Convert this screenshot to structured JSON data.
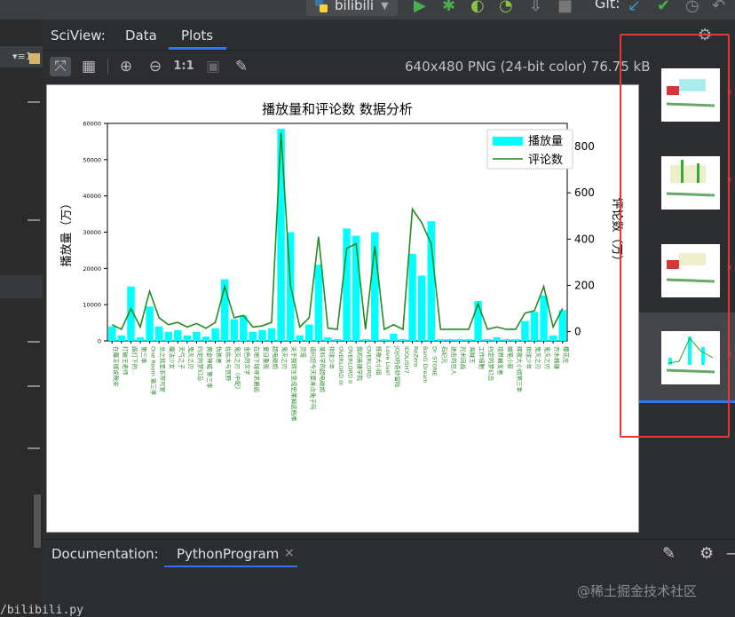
{
  "toolbar": {
    "run_config": "bilibili",
    "git_label": "Git:"
  },
  "left_strip": {
    "tab_label": "▾≡1"
  },
  "sciview": {
    "title": "SciView:",
    "tabs": [
      {
        "label": "Data"
      },
      {
        "label": "Plots"
      }
    ],
    "image_info": "640x480 PNG (24-bit color) 76.75 kB",
    "zoom_actual_label": "1:1"
  },
  "documentation": {
    "label": "Documentation:",
    "tab": "PythonProgram",
    "close": "×"
  },
  "watermark": "@稀土掘金技术社区",
  "console_line": "/bilibili.py",
  "chart_data": {
    "type": "bar",
    "title": "播放量和评论数 数据分析",
    "ylabel": "播放量（万）",
    "y2label": "评论数（万）",
    "ylim": [
      0,
      60000
    ],
    "y2lim": [
      -40,
      900
    ],
    "yticks": [
      0,
      10000,
      20000,
      30000,
      40000,
      50000,
      60000
    ],
    "y2ticks": [
      0,
      200,
      400,
      600,
      800
    ],
    "legend_position": "top-right",
    "series": [
      {
        "name": "播放量",
        "kind": "bar",
        "color": "#00ffff",
        "values": [
          4000,
          1500,
          15000,
          1000,
          9500,
          4000,
          2500,
          3000,
          1500,
          2500,
          1200,
          3500,
          17000,
          6000,
          7000,
          2500,
          3000,
          3500,
          58500,
          30000,
          1500,
          4500,
          21000,
          1000,
          500,
          31000,
          29000,
          500,
          30000,
          500,
          2000,
          500,
          24000,
          18000,
          33000,
          500,
          500,
          500,
          500,
          11000,
          500,
          1000,
          500,
          500,
          5500,
          8000,
          12500,
          1500,
          8500
        ]
      },
      {
        "name": "评论数",
        "kind": "line",
        "color": "#228b22",
        "values": [
          30,
          10,
          100,
          20,
          175,
          60,
          30,
          40,
          20,
          35,
          15,
          40,
          195,
          60,
          70,
          20,
          25,
          40,
          860,
          200,
          20,
          60,
          410,
          15,
          10,
          360,
          380,
          10,
          370,
          10,
          30,
          10,
          530,
          470,
          380,
          10,
          10,
          10,
          10,
          120,
          10,
          20,
          10,
          10,
          80,
          90,
          195,
          20,
          100
        ]
      }
    ],
    "categories": [
      "在魔王城说晚安",
      "打破王老师",
      "路灯下的...",
      "第三季",
      "One Room 第三季",
      "总之就是非常可爱",
      "魔法少女",
      "天气之子",
      "鬼灭之刃",
      "约定的梦幻岛",
      "黄金神威 第三季",
      "伪装者",
      "佐佐木与宫野",
      "鬼灭之刃（中配）",
      "金色的文字",
      "在地下城寻求邂逅",
      "夏日重现",
      "超电磁炮",
      "鬼灭之刃",
      "关于我转生变成史莱姆这档事",
      "灵笼",
      "请问您今天要来点兔子吗",
      "某科学的超电磁炮",
      "排球少年",
      "OVERLORD III",
      "OVERLORD II",
      "我的英雄学院",
      "OVERLORD",
      "辉夜大小姐",
      "Love Live!",
      "JOJO的奇妙冒险",
      "IDOLiSH7",
      "ReZero",
      "BanG Dream",
      "Dr. STONE",
      "石纪元",
      "进击的巨人",
      "咒术回战",
      "海贼王",
      "工作细胞",
      "约定的梦幻岛",
      "境界触发者",
      "蜡笔小新",
      "辉夜大小姐第三季",
      "排球少年",
      "鬼灭之刃",
      "鬼灭之刃",
      "齐木楠雄",
      "樱花庄"
    ]
  },
  "thumbnails": [
    {
      "label": "plot-1"
    },
    {
      "label": "plot-2"
    },
    {
      "label": "plot-3"
    },
    {
      "label": "plot-4"
    }
  ]
}
